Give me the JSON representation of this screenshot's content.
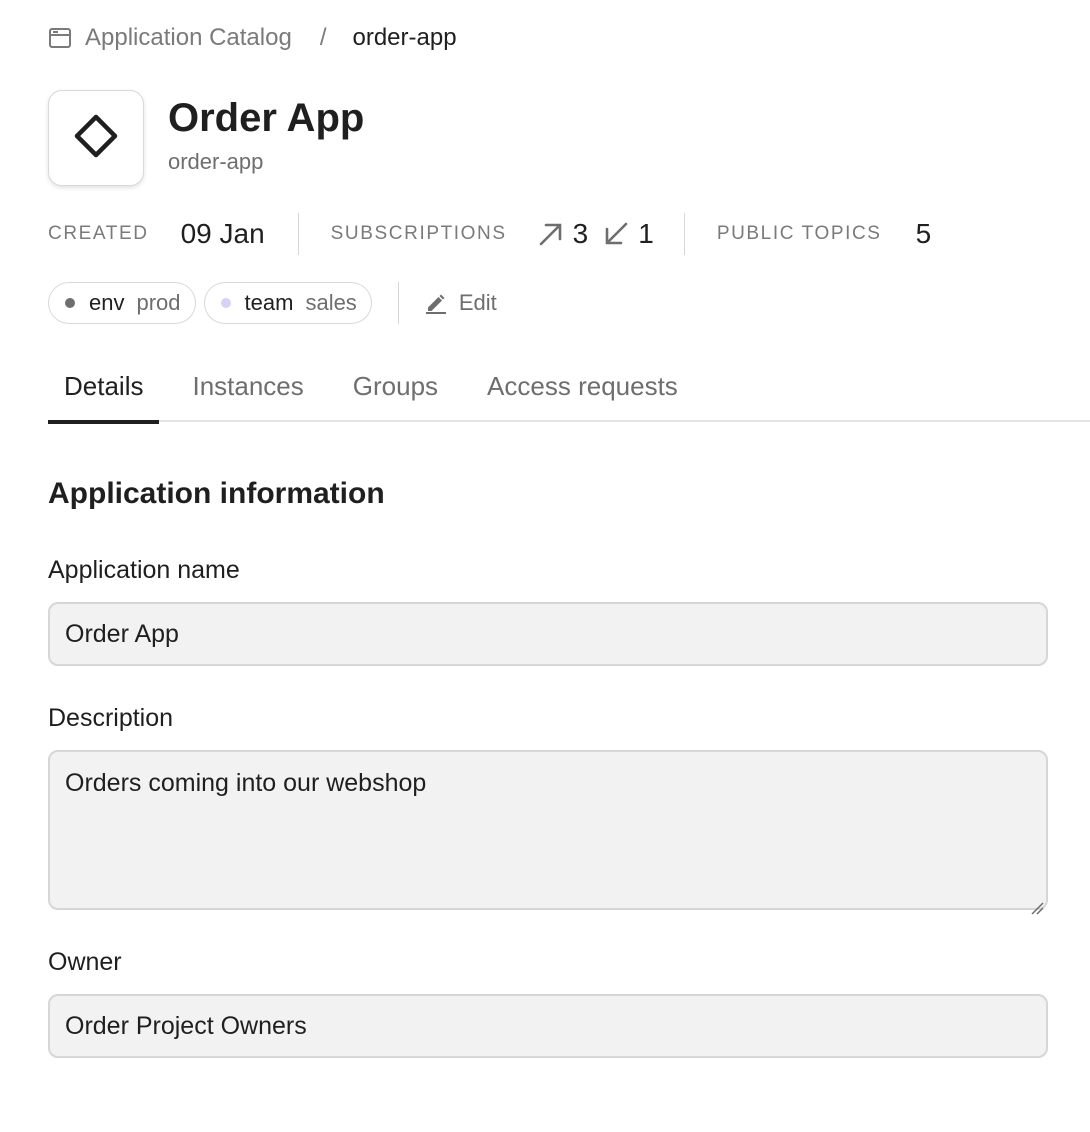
{
  "breadcrumb": {
    "icon": "catalog-window-icon",
    "parent_label": "Application Catalog",
    "separator": "/",
    "current_label": "order-app"
  },
  "header": {
    "logo_icon": "diamond-icon",
    "title": "Order App",
    "slug": "order-app"
  },
  "stats": {
    "created_label": "CREATED",
    "created_value": "09 Jan",
    "subscriptions_label": "SUBSCRIPTIONS",
    "subscriptions_outgoing": "3",
    "subscriptions_incoming": "1",
    "public_topics_label": "PUBLIC TOPICS",
    "public_topics_value": "5"
  },
  "tags": [
    {
      "key": "env",
      "value": "prod",
      "dot_color": "#6e6e6e"
    },
    {
      "key": "team",
      "value": "sales",
      "dot_color": "#d8d0f5"
    }
  ],
  "edit_label": "Edit",
  "tabs": [
    {
      "label": "Details",
      "active": true
    },
    {
      "label": "Instances",
      "active": false
    },
    {
      "label": "Groups",
      "active": false
    },
    {
      "label": "Access requests",
      "active": false
    }
  ],
  "form": {
    "section_title": "Application information",
    "name_label": "Application name",
    "name_value": "Order App",
    "description_label": "Description",
    "description_value": "Orders coming into our webshop",
    "owner_label": "Owner",
    "owner_value": "Order Project Owners"
  }
}
